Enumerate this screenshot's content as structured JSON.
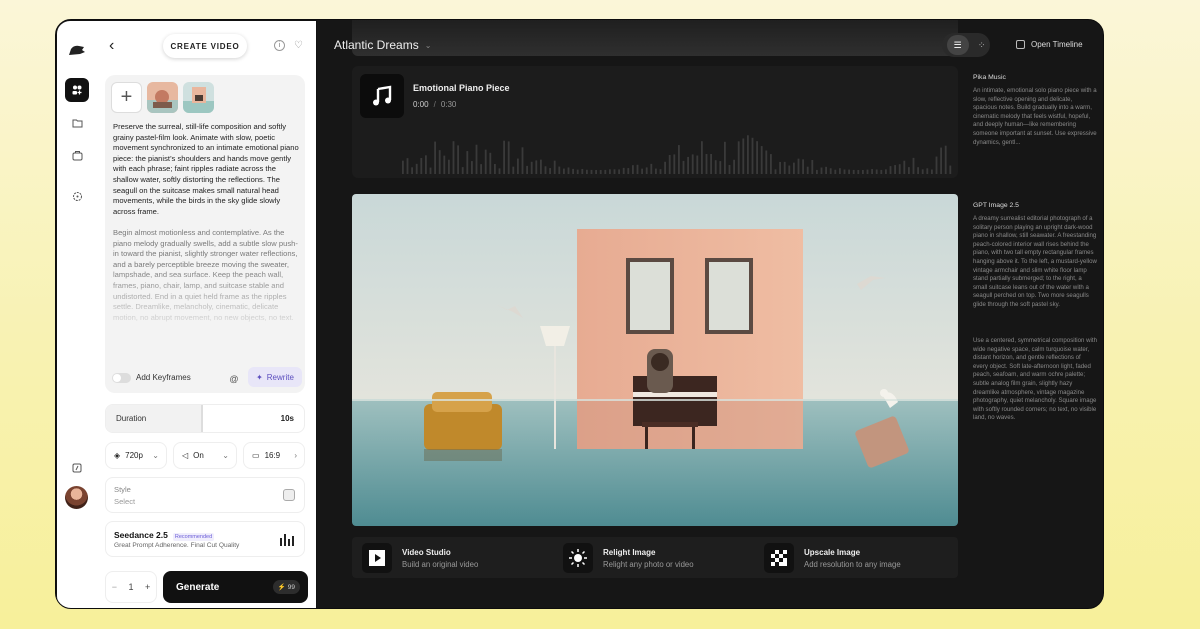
{
  "header": {
    "project_title": "Atlantic Dreams",
    "open_timeline_label": "Open Timeline"
  },
  "left_panel": {
    "create_label": "CREATE VIDEO",
    "prompt_text": "Preserve the surreal, still-life composition and softly grainy pastel-film look. Animate with slow, poetic movement synchronized to an intimate emotional piano piece: the pianist’s shoulders and hands move gently with each phrase; faint ripples radiate across the shallow water, softly distorting the reflections. The seagull on the suitcase makes small natural head movements, while the birds in the sky glide slowly across frame.",
    "prompt_text_faded": "Begin almost motionless and contemplative. As the piano melody gradually swells, add a subtle slow push-in toward the pianist, slightly stronger water reflections, and a barely perceptible breeze moving the sweater, lampshade, and sea surface. Keep the peach wall, frames, piano, chair, lamp, and suitcase stable and undistorted. End in a quiet held frame as the ripples settle. Dreamlike, melancholy, cinematic, delicate motion, no abrupt movement, no new objects, no text.",
    "add_keyframes_label": "Add Keyframes",
    "at_symbol": "@",
    "rewrite_label": "Rewrite",
    "duration_label": "Duration",
    "duration_value": "10s",
    "duration_fraction": 0.49,
    "resolution": "720p",
    "audio": "On",
    "aspect_ratio": "16:9",
    "style_label": "Style",
    "style_value": "Select",
    "model_name": "Seedance 2.5",
    "model_badge": "Recommended",
    "model_desc": "Great Prompt Adherence. Final Cut Quality",
    "quantity": "1",
    "minus": "−",
    "plus": "+",
    "generate_label": "Generate",
    "credits": "99"
  },
  "music": {
    "title": "Emotional Piano Piece",
    "current_time": "0:00",
    "separator": "/",
    "total_time": "0:30"
  },
  "side": {
    "music_model": "Pika Music",
    "music_desc": "An intimate, emotional solo piano piece with a slow, reflective opening and delicate, spacious notes. Build gradually into a warm, cinematic melody that feels wistful, hopeful, and deeply human—like remembering someone important at sunset. Use expressive dynamics, gentl...",
    "image_model": "GPT Image 2.5",
    "image_desc1": "A dreamy surrealist editorial photograph of a solitary person playing an upright dark-wood piano in shallow, still seawater. A freestanding peach-colored interior wall rises behind the piano, with two tall empty rectangular frames hanging above it. To the left, a mustard-yellow vintage armchair and slim white floor lamp stand partially submerged; to the right, a small suitcase leans out of the water with a seagull perched on top. Two more seagulls glide through the soft pastel sky.",
    "image_desc2": "Use a centered, symmetrical composition with wide negative space, calm turquoise water, distant horizon, and gentle reflections of every object. Soft late-afternoon light, faded peach, seafoam, and warm ochre palette; subtle analog film grain, slightly hazy dreamlike atmosphere, vintage magazine photography, quiet melancholy. Square image with softly rounded corners; no text, no visible land, no waves."
  },
  "tools": [
    {
      "title": "Video Studio",
      "subtitle": "Build an original video",
      "icon": "play-icon"
    },
    {
      "title": "Relight Image",
      "subtitle": "Relight any photo or video",
      "icon": "sun-icon"
    },
    {
      "title": "Upscale Image",
      "subtitle": "Add resolution to any image",
      "icon": "checker-icon"
    }
  ],
  "colors": {
    "app_bg": "#161616",
    "accent_purple": "#5c4fbf",
    "generate_bg": "#111111"
  }
}
